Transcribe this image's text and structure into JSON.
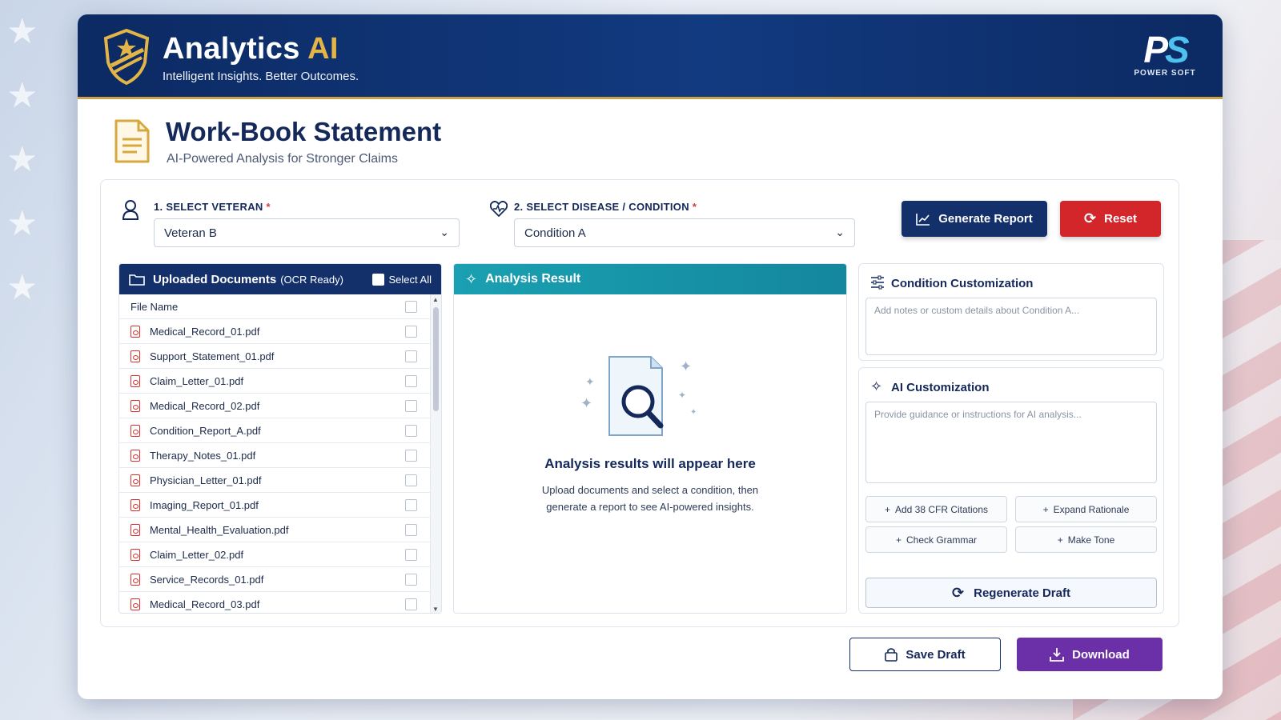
{
  "header": {
    "brand_title": "Analytics",
    "brand_title_accent": "AI",
    "brand_tagline": "Intelligent Insights. Better Outcomes.",
    "partner_logo_mark": "PS",
    "partner_logo_text": "POWER SOFT"
  },
  "page": {
    "title": "Work-Book Statement",
    "subtitle": "AI-Powered Analysis for Stronger Claims"
  },
  "selectors": {
    "veteran_label": "1. SELECT VETERAN",
    "veteran_value": "Veteran B",
    "condition_label": "2. SELECT DISEASE / CONDITION",
    "condition_value": "Condition A",
    "required_mark": "*"
  },
  "actions": {
    "generate_report": "Generate Report",
    "reset": "Reset",
    "save_draft": "Save Draft",
    "download": "Download"
  },
  "documents": {
    "title": "Uploaded Documents",
    "title_suffix": "(OCR Ready)",
    "select_all": "Select All",
    "column_header": "File Name",
    "files": [
      "Medical_Record_01.pdf",
      "Support_Statement_01.pdf",
      "Claim_Letter_01.pdf",
      "Medical_Record_02.pdf",
      "Condition_Report_A.pdf",
      "Therapy_Notes_01.pdf",
      "Physician_Letter_01.pdf",
      "Imaging_Report_01.pdf",
      "Mental_Health_Evaluation.pdf",
      "Claim_Letter_02.pdf",
      "Service_Records_01.pdf",
      "Medical_Record_03.pdf"
    ]
  },
  "analysis": {
    "title": "Analysis Result",
    "empty_title": "Analysis results will appear here",
    "empty_line1": "Upload documents and select a condition, then",
    "empty_line2": "generate a report to see AI-powered insights."
  },
  "condition_customization": {
    "title": "Condition Customization",
    "placeholder": "Add notes or custom details about Condition A..."
  },
  "ai_customization": {
    "title": "AI Customization",
    "placeholder": "Provide guidance or instructions for AI analysis...",
    "chips": [
      "Add 38 CFR Citations",
      "Expand Rationale",
      "Check Grammar",
      "Make Tone"
    ],
    "regenerate": "Regenerate Draft"
  },
  "colors": {
    "navy": "#13306b",
    "gold": "#c9a24a",
    "red": "#d3262b",
    "teal": "#1aa0b2",
    "purple": "#6b2fa8"
  }
}
